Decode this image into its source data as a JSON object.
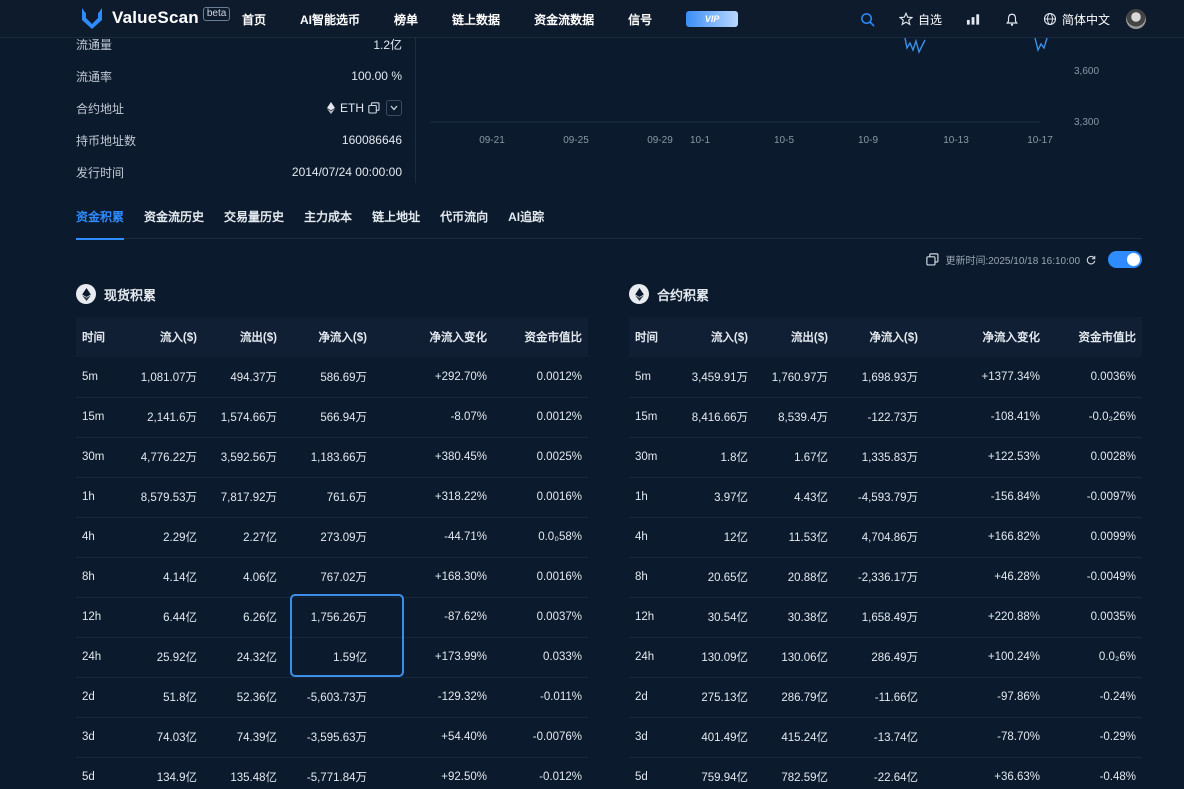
{
  "header": {
    "brand": "ValueScan",
    "beta": "beta",
    "nav": [
      "首页",
      "AI智能选币",
      "榜单",
      "链上数据",
      "资金流数据",
      "信号"
    ],
    "vip": "VIP",
    "watchlist": "自选",
    "language": "简体中文"
  },
  "info": [
    {
      "key": "流通量",
      "value": "1.2亿"
    },
    {
      "key": "流通率",
      "value": "100.00 %"
    },
    {
      "key": "合约地址",
      "value": "ETH"
    },
    {
      "key": "持币地址数",
      "value": "160086646"
    },
    {
      "key": "发行时间",
      "value": "2014/07/24 00:00:00"
    }
  ],
  "mini_chart": {
    "x_labels": [
      "09-21",
      "09-25",
      "09-29",
      "10-1",
      "10-5",
      "10-9",
      "10-13",
      "10-17"
    ],
    "y_labels": [
      "3,600",
      "3,300"
    ]
  },
  "tabs": [
    "资金积累",
    "资金流历史",
    "交易量历史",
    "主力成本",
    "链上地址",
    "代币流向",
    "AI追踪"
  ],
  "update_time": "更新时间:2025/10/18 16:10:00",
  "spot": {
    "title": "现货积累",
    "headers": [
      "时间",
      "流入($)",
      "流出($)",
      "净流入($)",
      "净流入变化",
      "资金市值比"
    ],
    "rows": [
      [
        "5m",
        "1,081.07万",
        "494.37万",
        "586.69万",
        "+292.70%",
        "0.0012%"
      ],
      [
        "15m",
        "2,141.6万",
        "1,574.66万",
        "566.94万",
        "-8.07%",
        "0.0012%"
      ],
      [
        "30m",
        "4,776.22万",
        "3,592.56万",
        "1,183.66万",
        "+380.45%",
        "0.0025%"
      ],
      [
        "1h",
        "8,579.53万",
        "7,817.92万",
        "761.6万",
        "+318.22%",
        "0.0016%"
      ],
      [
        "4h",
        "2.29亿",
        "2.27亿",
        "273.09万",
        "-44.71%",
        "0.0₀58%"
      ],
      [
        "8h",
        "4.14亿",
        "4.06亿",
        "767.02万",
        "+168.30%",
        "0.0016%"
      ],
      [
        "12h",
        "6.44亿",
        "6.26亿",
        "1,756.26万",
        "-87.62%",
        "0.0037%"
      ],
      [
        "24h",
        "25.92亿",
        "24.32亿",
        "1.59亿",
        "+173.99%",
        "0.033%"
      ],
      [
        "2d",
        "51.8亿",
        "52.36亿",
        "-5,603.73万",
        "-129.32%",
        "-0.011%"
      ],
      [
        "3d",
        "74.03亿",
        "74.39亿",
        "-3,595.63万",
        "+54.40%",
        "-0.0076%"
      ],
      [
        "5d",
        "134.9亿",
        "135.48亿",
        "-5,771.84万",
        "+92.50%",
        "-0.012%"
      ]
    ]
  },
  "futures": {
    "title": "合约积累",
    "headers": [
      "时间",
      "流入($)",
      "流出($)",
      "净流入($)",
      "净流入变化",
      "资金市值比"
    ],
    "rows": [
      [
        "5m",
        "3,459.91万",
        "1,760.97万",
        "1,698.93万",
        "+1377.34%",
        "0.0036%"
      ],
      [
        "15m",
        "8,416.66万",
        "8,539.4万",
        "-122.73万",
        "-108.41%",
        "-0.0₂26%"
      ],
      [
        "30m",
        "1.8亿",
        "1.67亿",
        "1,335.83万",
        "+122.53%",
        "0.0028%"
      ],
      [
        "1h",
        "3.97亿",
        "4.43亿",
        "-4,593.79万",
        "-156.84%",
        "-0.0097%"
      ],
      [
        "4h",
        "12亿",
        "11.53亿",
        "4,704.86万",
        "+166.82%",
        "0.0099%"
      ],
      [
        "8h",
        "20.65亿",
        "20.88亿",
        "-2,336.17万",
        "+46.28%",
        "-0.0049%"
      ],
      [
        "12h",
        "30.54亿",
        "30.38亿",
        "1,658.49万",
        "+220.88%",
        "0.0035%"
      ],
      [
        "24h",
        "130.09亿",
        "130.06亿",
        "286.49万",
        "+100.24%",
        "0.0₂6%"
      ],
      [
        "2d",
        "275.13亿",
        "286.79亿",
        "-11.66亿",
        "-97.86%",
        "-0.24%"
      ],
      [
        "3d",
        "401.49亿",
        "415.24亿",
        "-13.74亿",
        "-78.70%",
        "-0.29%"
      ],
      [
        "5d",
        "759.94亿",
        "782.59亿",
        "-22.64亿",
        "+36.63%",
        "-0.48%"
      ]
    ]
  }
}
